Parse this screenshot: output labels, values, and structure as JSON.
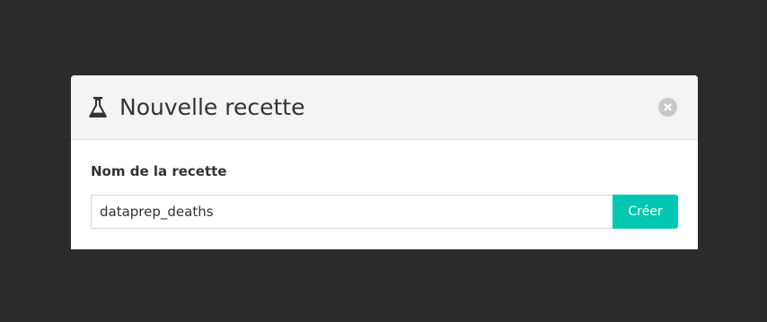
{
  "modal": {
    "title": "Nouvelle recette",
    "icon": "flask-icon",
    "close_icon": "close-icon"
  },
  "form": {
    "label": "Nom de la recette",
    "input_value": "dataprep_deaths",
    "submit_label": "Créer"
  },
  "colors": {
    "backdrop": "#2b2b2b",
    "header_bg": "#f4f4f4",
    "accent": "#00c8b0",
    "close_bg": "#c8c8c8"
  }
}
